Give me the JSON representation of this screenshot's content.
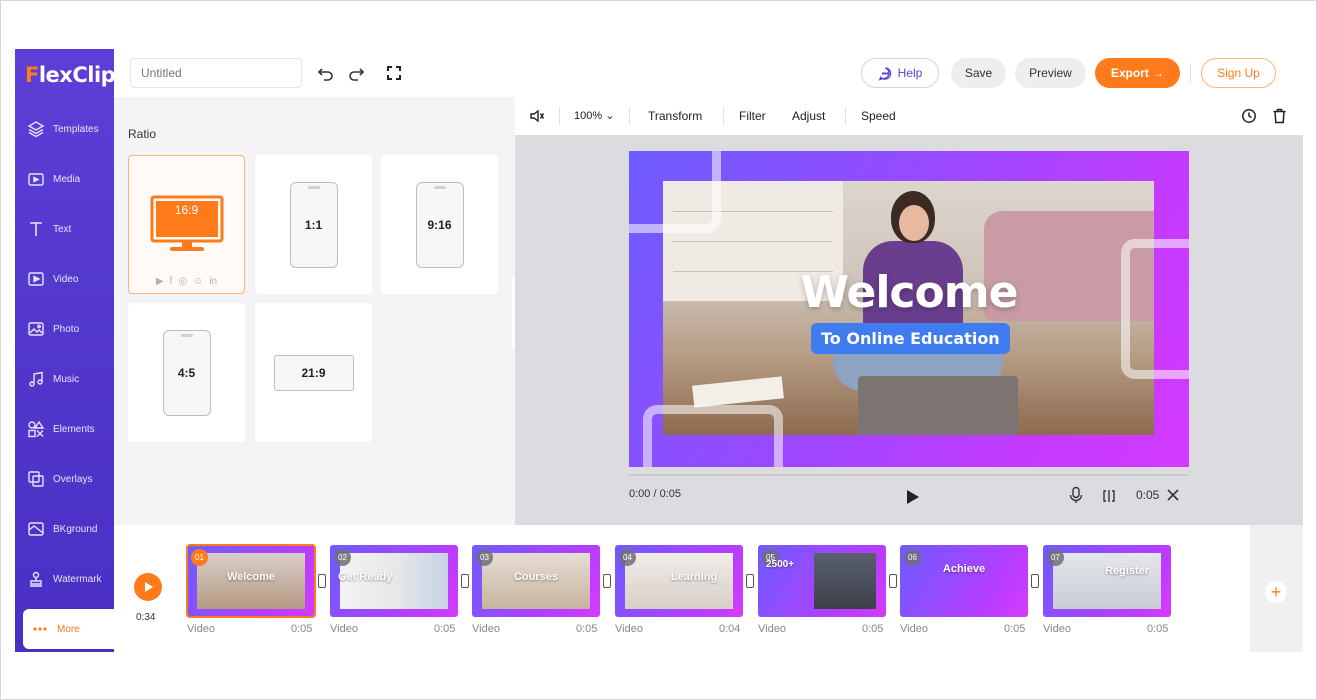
{
  "app": {
    "logo": "FlexClip"
  },
  "sidebar": {
    "items": [
      {
        "label": "Templates",
        "icon": "layers-icon"
      },
      {
        "label": "Media",
        "icon": "folder-icon"
      },
      {
        "label": "Text",
        "icon": "text-icon"
      },
      {
        "label": "Video",
        "icon": "video-icon"
      },
      {
        "label": "Photo",
        "icon": "photo-icon"
      },
      {
        "label": "Music",
        "icon": "music-icon"
      },
      {
        "label": "Elements",
        "icon": "elements-icon"
      },
      {
        "label": "Overlays",
        "icon": "overlays-icon"
      },
      {
        "label": "BKground",
        "icon": "background-icon"
      },
      {
        "label": "Watermark",
        "icon": "watermark-icon"
      },
      {
        "label": "More",
        "icon": "more-icon"
      }
    ]
  },
  "topbar": {
    "title_placeholder": "Untitled",
    "help": "Help",
    "save": "Save",
    "preview": "Preview",
    "export": "Export →",
    "signup": "Sign Up"
  },
  "ratio_panel": {
    "title": "Ratio",
    "options": [
      "16:9",
      "1:1",
      "9:16",
      "4:5",
      "21:9"
    ],
    "selected": "16:9"
  },
  "toolbar": {
    "zoom": "100%",
    "transform": "Transform",
    "filter": "Filter",
    "adjust": "Adjust",
    "speed": "Speed"
  },
  "canvas": {
    "headline": "Welcome",
    "subheadline": "To Online Education"
  },
  "player": {
    "current_time": "0:00 / 0:05",
    "duration": "0:05"
  },
  "timeline": {
    "total_time": "0:34",
    "clips": [
      {
        "num": "01",
        "text": "Welcome",
        "label": "Video",
        "duration": "0:05"
      },
      {
        "num": "02",
        "text": "Get Ready",
        "label": "Video",
        "duration": "0:05"
      },
      {
        "num": "03",
        "text": "Courses",
        "label": "Video",
        "duration": "0:05"
      },
      {
        "num": "04",
        "text": "Learning",
        "label": "Video",
        "duration": "0:04"
      },
      {
        "num": "05",
        "text": "2500+",
        "label": "Video",
        "duration": "0:05"
      },
      {
        "num": "06",
        "text": "Achieve",
        "label": "Video",
        "duration": "0:05"
      },
      {
        "num": "07",
        "text": "Register",
        "label": "Video",
        "duration": "0:05"
      }
    ]
  },
  "colors": {
    "brand_purple": "#5b3fd6",
    "accent_orange": "#ff7a1a"
  }
}
